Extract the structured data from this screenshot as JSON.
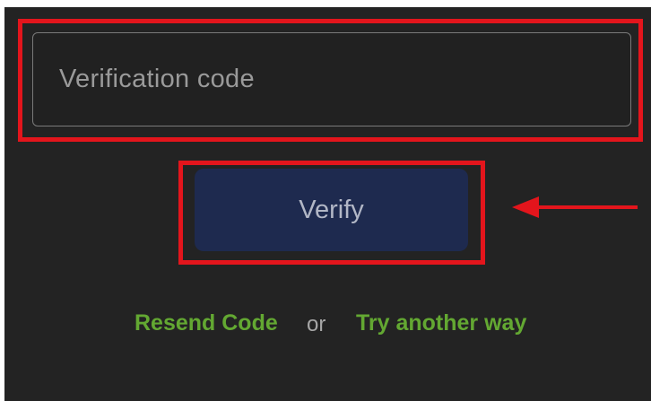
{
  "verification": {
    "input_placeholder": "Verification code",
    "input_value": ""
  },
  "actions": {
    "verify_label": "Verify",
    "resend_label": "Resend Code",
    "separator": "or",
    "alternate_label": "Try another way"
  },
  "annotations": {
    "highlight_color": "#e3151c",
    "arrow_icon": "arrow-left-icon"
  },
  "colors": {
    "background": "#232323",
    "button_bg": "#1e2a4f",
    "link": "#63a832",
    "input_border": "#7a7a7a"
  }
}
